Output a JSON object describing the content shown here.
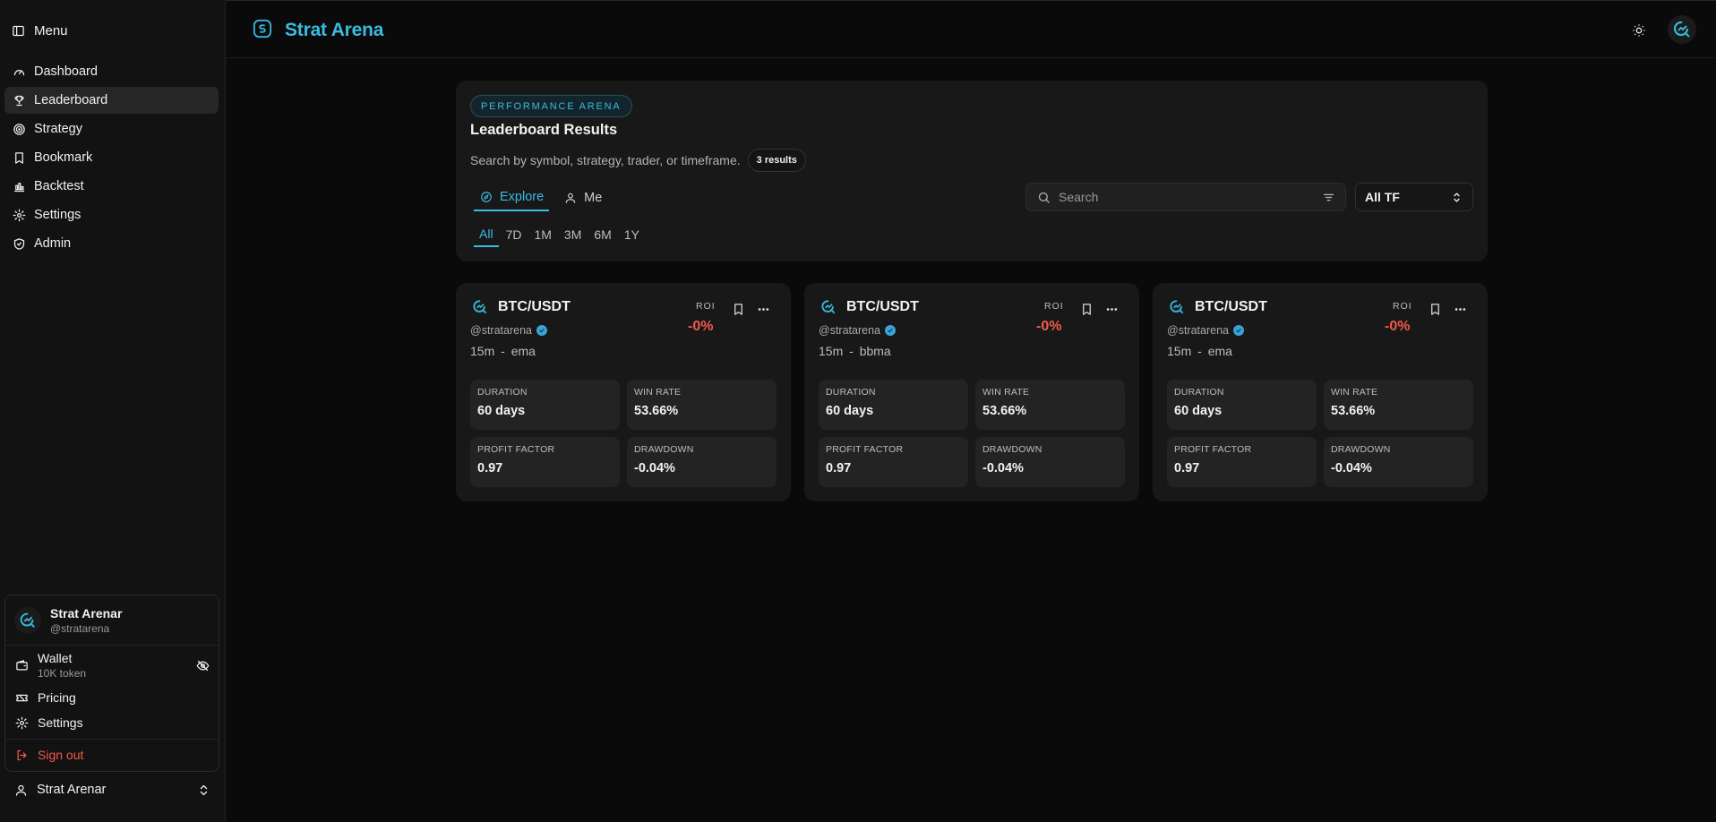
{
  "app": {
    "title": "Strat Arena"
  },
  "sidebar": {
    "menu_label": "Menu",
    "items": [
      {
        "label": "Dashboard",
        "icon": "gauge-icon"
      },
      {
        "label": "Leaderboard",
        "icon": "trophy-icon",
        "active": true
      },
      {
        "label": "Strategy",
        "icon": "target-icon"
      },
      {
        "label": "Bookmark",
        "icon": "bookmark-icon"
      },
      {
        "label": "Backtest",
        "icon": "chart-icon"
      },
      {
        "label": "Settings",
        "icon": "gear-icon"
      },
      {
        "label": "Admin",
        "icon": "shield-icon"
      }
    ],
    "user_menu": {
      "name": "Strat Arenar",
      "handle": "@stratarena",
      "wallet_label": "Wallet",
      "wallet_balance": "10K token",
      "pricing_label": "Pricing",
      "settings_label": "Settings",
      "signout_label": "Sign out"
    },
    "footer_user": "Strat Arenar"
  },
  "panel": {
    "badge": "PERFORMANCE ARENA",
    "title": "Leaderboard Results",
    "subtitle": "Search by symbol, strategy, trader, or timeframe.",
    "count": "3 results",
    "tabs": [
      {
        "label": "Explore",
        "active": true
      },
      {
        "label": "Me"
      }
    ],
    "periods": [
      "All",
      "7D",
      "1M",
      "3M",
      "6M",
      "1Y"
    ],
    "active_period": "All",
    "search_placeholder": "Search",
    "timeframe_value": "All TF"
  },
  "cards": [
    {
      "symbol": "BTC/USDT",
      "handle": "@stratarena",
      "timeframe": "15m",
      "separator": "-",
      "strategy": "ema",
      "roi_label": "ROI",
      "roi": "-0%",
      "stats": [
        {
          "label": "DURATION",
          "value": "60 days"
        },
        {
          "label": "WIN RATE",
          "value": "53.66%"
        },
        {
          "label": "PROFIT FACTOR",
          "value": "0.97"
        },
        {
          "label": "DRAWDOWN",
          "value": "-0.04%"
        }
      ]
    },
    {
      "symbol": "BTC/USDT",
      "handle": "@stratarena",
      "timeframe": "15m",
      "separator": "-",
      "strategy": "bbma",
      "roi_label": "ROI",
      "roi": "-0%",
      "stats": [
        {
          "label": "DURATION",
          "value": "60 days"
        },
        {
          "label": "WIN RATE",
          "value": "53.66%"
        },
        {
          "label": "PROFIT FACTOR",
          "value": "0.97"
        },
        {
          "label": "DRAWDOWN",
          "value": "-0.04%"
        }
      ]
    },
    {
      "symbol": "BTC/USDT",
      "handle": "@stratarena",
      "timeframe": "15m",
      "separator": "-",
      "strategy": "ema",
      "roi_label": "ROI",
      "roi": "-0%",
      "stats": [
        {
          "label": "DURATION",
          "value": "60 days"
        },
        {
          "label": "WIN RATE",
          "value": "53.66%"
        },
        {
          "label": "PROFIT FACTOR",
          "value": "0.97"
        },
        {
          "label": "DRAWDOWN",
          "value": "-0.04%"
        }
      ]
    }
  ],
  "colors": {
    "accent": "#3bbbe0",
    "negative": "#f05a4a",
    "background": "#0a0a0a",
    "surface": "#181818"
  }
}
